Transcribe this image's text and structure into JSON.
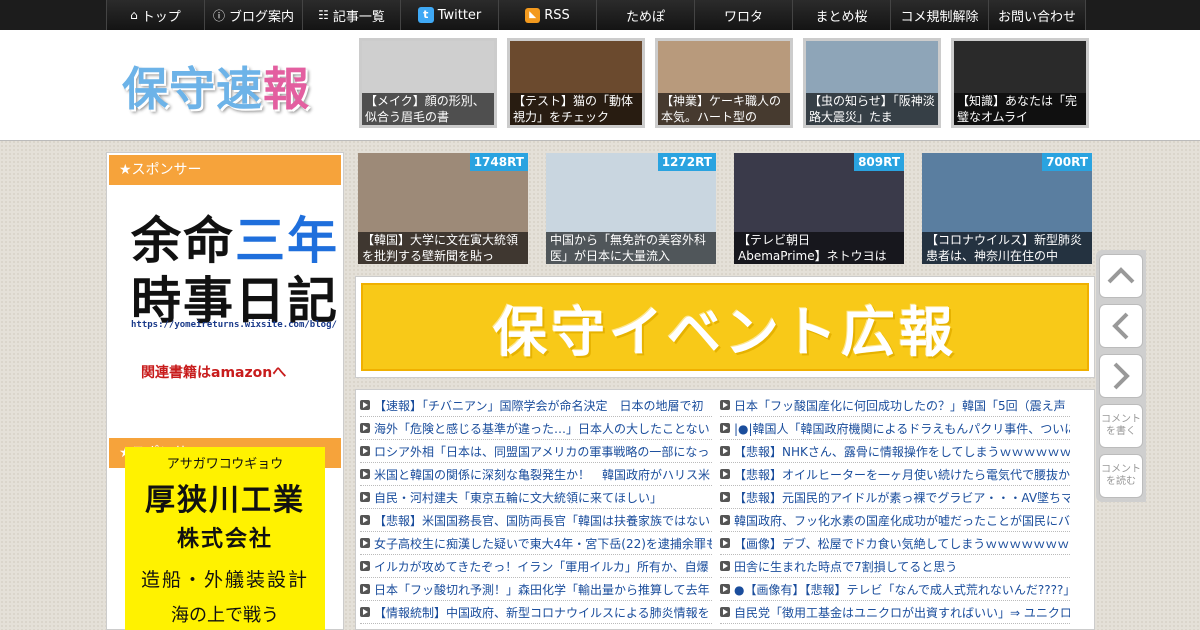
{
  "nav": {
    "items": [
      {
        "label": "トップ",
        "icon": "home-icon",
        "width": 98
      },
      {
        "label": "ブログ案内",
        "icon": "info-icon",
        "width": 98
      },
      {
        "label": "記事一覧",
        "icon": "list-icon",
        "width": 98
      },
      {
        "label": "Twitter",
        "icon": "twitter-icon",
        "width": 98
      },
      {
        "label": "RSS",
        "icon": "rss-icon",
        "width": 98
      },
      {
        "label": "ためぽ",
        "icon": "",
        "width": 98
      },
      {
        "label": "ワロタ",
        "icon": "",
        "width": 98
      },
      {
        "label": "まとめ桜",
        "icon": "",
        "width": 98
      },
      {
        "label": "コメ規制解除",
        "icon": "",
        "width": 98
      },
      {
        "label": "お問い合わせ",
        "icon": "",
        "width": 98
      }
    ]
  },
  "header": {
    "logo_main": "保守速",
    "logo_accent": "報"
  },
  "thumbs": [
    {
      "caption": "【メイク】顔の形別、似合う眉毛の書",
      "color": "#cfcfcf"
    },
    {
      "caption": "【テスト】猫の「動体視力」をチェック",
      "color": "#6b4a2e"
    },
    {
      "caption": "【神業】ケーキ職人の本気。ハート型の",
      "color": "#b89a7c"
    },
    {
      "caption": "【虫の知らせ】「阪神淡路大震災」たま",
      "color": "#8ea5b8"
    },
    {
      "caption": "【知識】あなたは「完璧なオムライ",
      "color": "#2a2a2a"
    }
  ],
  "sidebar": {
    "sponsor1_title": "★スポンサー",
    "ad1_line1": "余命",
    "ad1_line1_blue": "三年",
    "ad1_line2": "時事日記",
    "ad1_url": "https://yomeireturns.wixsite.com/blog/",
    "ad1_amazon": "関連書籍はamazonへ",
    "sponsor2_title": "★スポンサー",
    "ad2_kana": "アサガワコウギョウ",
    "ad2_name": "厚狭川工業",
    "ad2_corp": "株式会社",
    "ad2_biz": "造船・外艤装設計",
    "ad2_more": "海の上で戦う"
  },
  "ranking": [
    {
      "rt": "1748RT",
      "caption": "【韓国】大学に文在寅大統領を批判する壁新聞を貼っ",
      "color": "#9d8a78"
    },
    {
      "rt": "1272RT",
      "caption": "中国から「無免許の美容外科医」が日本に大量流入",
      "color": "#c9d6e0"
    },
    {
      "rt": "809RT",
      "caption": "【テレビ朝日　AbemaPrime】ネトウヨは",
      "color": "#3a3a4a"
    },
    {
      "rt": "700RT",
      "caption": "【コロナウイルス】新型肺炎患者は、神奈川在住の中",
      "color": "#5a7ea0"
    }
  ],
  "banner": {
    "text": "保守イベント広報"
  },
  "articles_left": [
    "【速報】「チバニアン」国際学会が命名決定　日本の地層で初",
    "海外「危険と感じる基準が違った…」日本人の大したことない",
    "ロシア外相「日本は、同盟国アメリカの軍事戦略の一部になっ",
    "米国と韓国の関係に深刻な亀裂発生か！　韓国政府がハリス米",
    "自民・河村建夫「東京五輪に文大統領に来てほしい」",
    "【悲報】米国国務長官、国防両長官「韓国は扶養家族ではない",
    "女子高校生に痴漢した疑いで東大4年・宮下岳(22)を逮捕余罪も",
    "イルカが攻めてきたぞっ！イラン「軍用イルカ」所有か、自爆",
    "日本「フッ酸切れ予測！」森田化学「輸出量から推算して去年",
    "【情報統制】中国政府、新型コロナウイルスによる肺炎情報を"
  ],
  "articles_right": [
    "日本「フッ酸国産化に何回成功したの？」韓国「5回（震え声",
    "|●|韓国人「韓国政府機関によるドラえもんパクリ事件、ついに",
    "【悲報】NHKさん、露骨に情報操作をしてしまうｗｗｗｗｗｗ",
    "【悲報】オイルヒーターを一ヶ月使い続けたら電気代で腰抜か",
    "【悲報】元国民的アイドルが素っ裸でグラビア・・・AV墜ちマ",
    "韓国政府、フッ化水素の国産化成功が嘘だったことが国民にバ",
    "【画像】デブ、松屋でドカ食い気絶してしまうｗｗｗｗｗｗｗ",
    "田舎に生まれた時点で7割損してると思う",
    "●【画像有】【悲報】テレビ「なんで成人式荒れないんだ????」",
    "自民党「徴用工基金はユニクロが出資すればいい」⇒ ユニクロ"
  ],
  "sidebtns": {
    "comment_write": "コメントを書く",
    "comment_read": "コメントを読む"
  }
}
